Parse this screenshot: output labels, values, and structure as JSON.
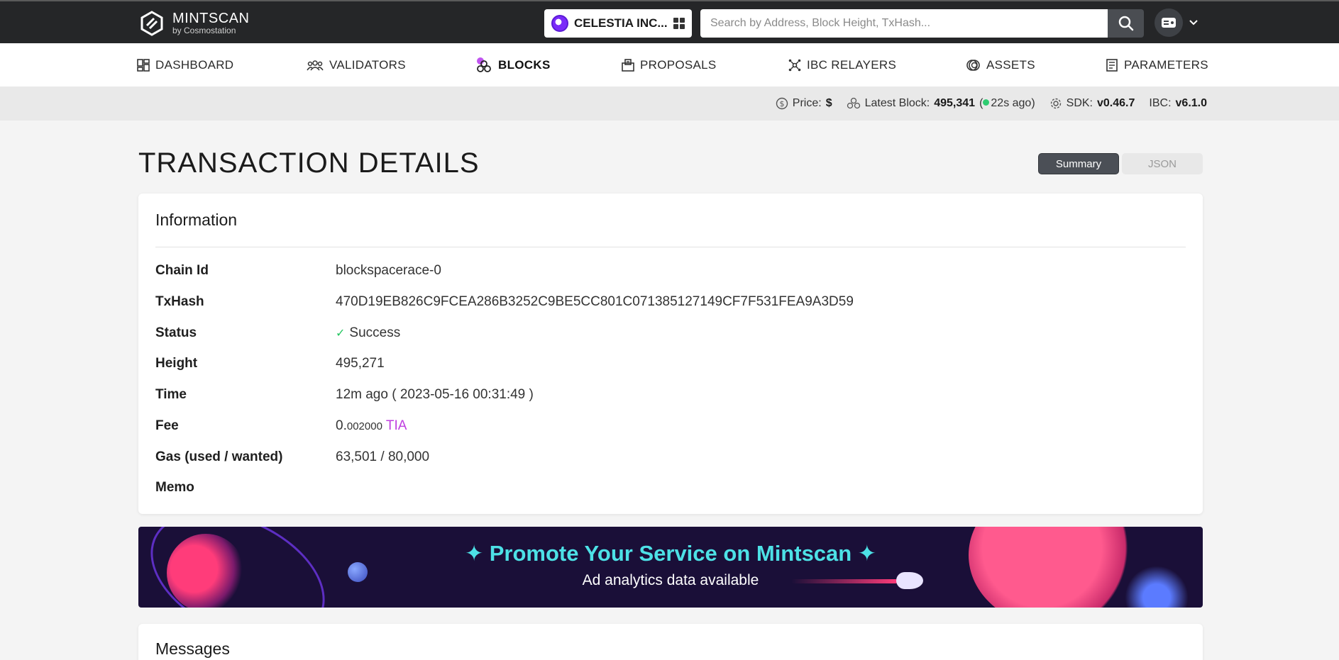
{
  "header": {
    "brand": "MINTSCAN",
    "brand_sub": "by Cosmostation",
    "chain_name": "CELESTIA INC...",
    "search_placeholder": "Search by Address, Block Height, TxHash..."
  },
  "nav": {
    "items": [
      {
        "label": "DASHBOARD",
        "icon": "dashboard-icon"
      },
      {
        "label": "VALIDATORS",
        "icon": "validators-icon"
      },
      {
        "label": "BLOCKS",
        "icon": "blocks-icon",
        "active": true
      },
      {
        "label": "PROPOSALS",
        "icon": "proposals-icon"
      },
      {
        "label": "IBC RELAYERS",
        "icon": "relayers-icon"
      },
      {
        "label": "ASSETS",
        "icon": "assets-icon"
      },
      {
        "label": "PARAMETERS",
        "icon": "parameters-icon"
      }
    ]
  },
  "status": {
    "price_label": "Price:",
    "price_value": "$",
    "latest_block_label": "Latest Block:",
    "latest_block_value": "495,341",
    "latest_block_ago": "22s ago",
    "sdk_label": "SDK:",
    "sdk_value": "v0.46.7",
    "ibc_label": "IBC:",
    "ibc_value": "v6.1.0"
  },
  "page": {
    "title": "TRANSACTION DETAILS",
    "toggle_summary": "Summary",
    "toggle_json": "JSON"
  },
  "info": {
    "title": "Information",
    "chain_id_label": "Chain Id",
    "chain_id": "blockspacerace-0",
    "txhash_label": "TxHash",
    "txhash": "470D19EB826C9FCEA286B3252C9BE5CC801C071385127149CF7F531FEA9A3D59",
    "status_label": "Status",
    "status": "Success",
    "height_label": "Height",
    "height": "495,271",
    "time_label": "Time",
    "time": "12m ago ( 2023-05-16 00:31:49 )",
    "fee_label": "Fee",
    "fee_int": "0.",
    "fee_dec": "002000",
    "fee_denom": "TIA",
    "gas_label": "Gas (used / wanted)",
    "gas": "63,501 / 80,000",
    "memo_label": "Memo",
    "memo": ""
  },
  "banner": {
    "headline": "✦ Promote Your Service on Mintscan ✦",
    "subline": "Ad analytics data available"
  },
  "messages": {
    "title": "Messages"
  },
  "colors": {
    "topbar": "#252628",
    "link": "#3e5fcf",
    "success": "#22c55e",
    "denom": "#c040e0",
    "banner_text": "#4de1e6"
  }
}
